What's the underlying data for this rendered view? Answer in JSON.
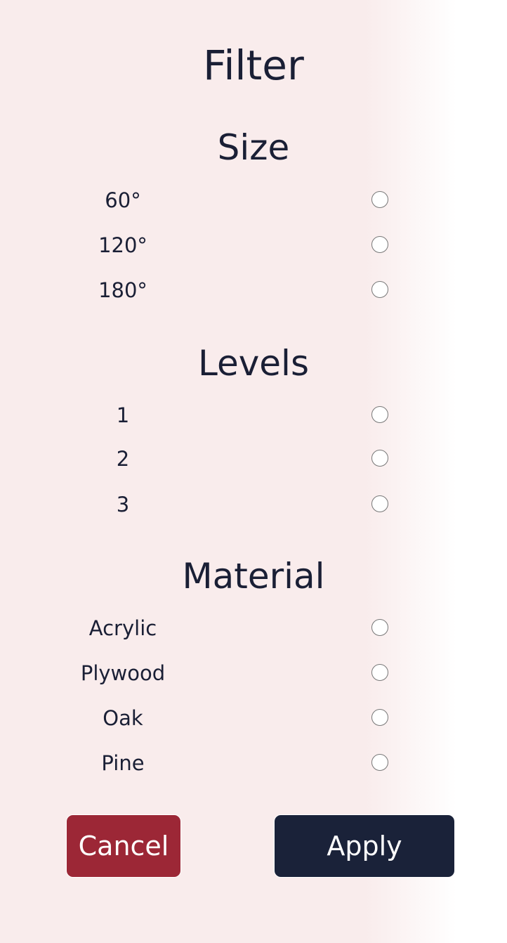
{
  "title": "Filter",
  "sections": [
    {
      "title": "Size",
      "options": [
        "60°",
        "120°",
        "180°"
      ]
    },
    {
      "title": "Levels",
      "options": [
        "1",
        "2",
        "3"
      ]
    },
    {
      "title": "Material",
      "options": [
        "Acrylic",
        "Plywood",
        "Oak",
        "Pine"
      ]
    }
  ],
  "buttons": {
    "cancel": "Cancel",
    "apply": "Apply"
  },
  "colors": {
    "text": "#1a1f35",
    "cancel": "#9c2736",
    "apply": "#1a2239",
    "background": "#f9ecec"
  }
}
